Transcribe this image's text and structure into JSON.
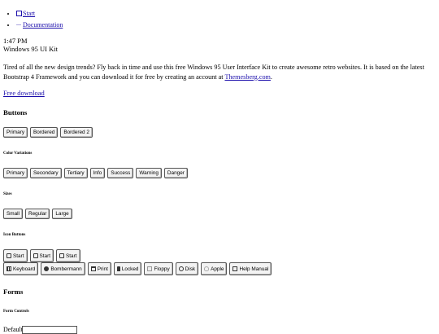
{
  "nav": {
    "start": "Start",
    "documentation": "Documentation"
  },
  "taskbar": {
    "time": "1:47 PM"
  },
  "title": "Windows 95 UI Kit",
  "intro": {
    "text": "Tired of all the new design trends? Fly back in time and use this free Windows 95 User Interface Kit to create awesome retro websites. It is based on the latest Bootstrap 4 Framework and you can download it for free by creating an account at ",
    "link": "Themesberg.com",
    "end": "."
  },
  "free_download": "Free download",
  "buttons": {
    "heading": "Buttons",
    "items": [
      "Primary",
      "Bordered",
      "Bordered 2"
    ]
  },
  "color_variations": {
    "heading": "Color Variations",
    "items": [
      "Primary",
      "Secondary",
      "Tertiary",
      "Info",
      "Success",
      "Warning",
      "Danger"
    ]
  },
  "sizes": {
    "heading": "Sizes",
    "items": [
      "Small",
      "Regular",
      "Large"
    ]
  },
  "icon_buttons": {
    "heading": "Icon Buttons",
    "row1": [
      "Start",
      "Start",
      "Start"
    ],
    "row2": [
      {
        "label": "Keyboard",
        "icon": "keyboard-icon"
      },
      {
        "label": "Bombermann",
        "icon": "bomb-icon"
      },
      {
        "label": "Print",
        "icon": "printer-icon"
      },
      {
        "label": "Locked",
        "icon": "lock-icon"
      },
      {
        "label": "Floppy",
        "icon": "floppy-icon"
      },
      {
        "label": "Disk",
        "icon": "disk-icon"
      },
      {
        "label": "Apple",
        "icon": "apple-icon"
      },
      {
        "label": "Help Manual",
        "icon": "help-icon"
      }
    ]
  },
  "forms": {
    "heading": "Forms",
    "controls_heading": "Form Controls",
    "default_label": "Default"
  }
}
